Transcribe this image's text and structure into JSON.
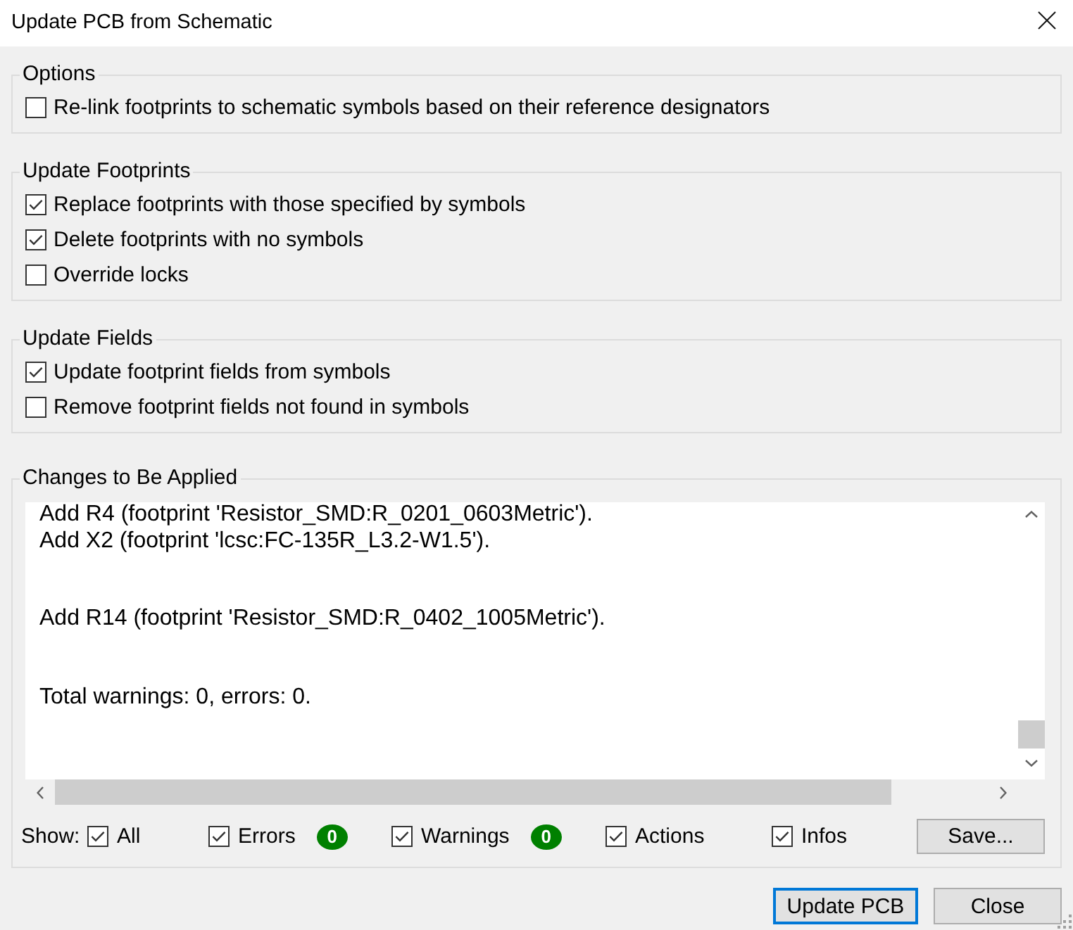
{
  "window": {
    "title": "Update PCB from Schematic"
  },
  "groups": [
    {
      "title": "Options",
      "options": [
        {
          "label": "Re-link footprints to schematic symbols based on their reference designators",
          "checked": false
        }
      ]
    },
    {
      "title": "Update Footprints",
      "options": [
        {
          "label": "Replace footprints with those specified by symbols",
          "checked": true
        },
        {
          "label": "Delete footprints with no symbols",
          "checked": true
        },
        {
          "label": "Override locks",
          "checked": false
        }
      ]
    },
    {
      "title": "Update Fields",
      "options": [
        {
          "label": "Update footprint fields from symbols",
          "checked": true
        },
        {
          "label": "Remove footprint fields not found in symbols",
          "checked": false
        }
      ]
    }
  ],
  "changes": {
    "title": "Changes to Be Applied",
    "blocks": [
      {
        "lines": [
          "Add R4 (footprint 'Resistor_SMD:R_0201_0603Metric').",
          "Add X2 (footprint 'lcsc:FC-135R_L3.2-W1.5')."
        ]
      },
      {
        "lines": [
          "Add R14 (footprint 'Resistor_SMD:R_0402_1005Metric')."
        ]
      },
      {
        "lines": [
          "Total warnings: 0, errors: 0."
        ]
      }
    ],
    "show_label": "Show:",
    "filters": [
      {
        "label": "All",
        "checked": true
      },
      {
        "label": "Errors",
        "checked": true,
        "count": "0"
      },
      {
        "label": "Warnings",
        "checked": true,
        "count": "0"
      },
      {
        "label": "Actions",
        "checked": true
      },
      {
        "label": "Infos",
        "checked": true
      }
    ],
    "save_button": "Save..."
  },
  "buttons": [
    {
      "label": "Update PCB",
      "default": true
    },
    {
      "label": "Close",
      "default": false
    }
  ]
}
